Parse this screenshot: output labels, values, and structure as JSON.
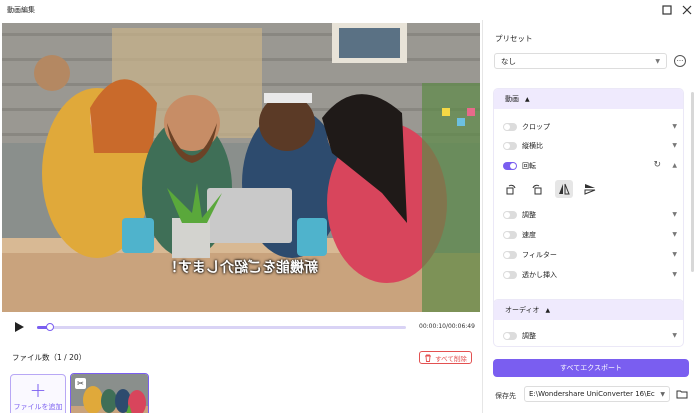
{
  "window": {
    "title": "動画編集"
  },
  "video": {
    "subtitle": "新機能をご紹介します！"
  },
  "player": {
    "time": "00:00:10/00:06:49",
    "progress": 0.03
  },
  "files": {
    "count_label": "ファイル数（1 / 20）",
    "delete_all": "すべて削除",
    "add_file": "ファイルを追加"
  },
  "preset": {
    "label": "プリセット",
    "value": "なし"
  },
  "video_section": {
    "title": "動画",
    "items": [
      {
        "label": "クロップ",
        "on": false
      },
      {
        "label": "縦横比",
        "on": false
      },
      {
        "label": "回転",
        "on": true
      },
      {
        "label": "調整",
        "on": false
      },
      {
        "label": "速度",
        "on": false
      },
      {
        "label": "フィルター",
        "on": false
      },
      {
        "label": "透かし挿入",
        "on": false
      }
    ]
  },
  "audio_section": {
    "title": "オーディオ",
    "items": [
      {
        "label": "調整",
        "on": false
      }
    ]
  },
  "export": {
    "label": "すべてエクスポート"
  },
  "save": {
    "label": "保存先",
    "path": "E:\\Wondershare UniConverter 16\\Ec"
  },
  "colors": {
    "accent": "#7a5ef0",
    "danger": "#e35151",
    "panel_head": "#efeafd"
  }
}
